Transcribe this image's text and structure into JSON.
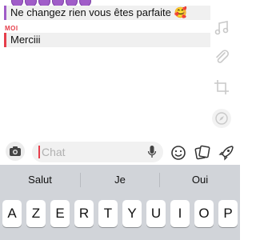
{
  "conversation": {
    "friend_message": "Ne changez rien vous êtes parfaite 🥰",
    "me_label": "MOI",
    "my_message": "Merciii"
  },
  "input": {
    "placeholder": "Chat"
  },
  "keyboard": {
    "suggestions": [
      "Salut",
      "Je",
      "Oui"
    ],
    "keys": [
      "A",
      "Z",
      "E",
      "R",
      "T",
      "Y",
      "U",
      "I",
      "O",
      "P"
    ]
  },
  "colors": {
    "friend_accent": "#a05cc8",
    "me_accent": "#e63e4b",
    "keyboard_bg": "#d1d4d9"
  },
  "icons": [
    "music-note-icon",
    "paperclip-icon",
    "crop-icon",
    "compass-icon",
    "camera-icon",
    "microphone-icon",
    "smiley-icon",
    "sticker-icon",
    "rocket-icon"
  ]
}
